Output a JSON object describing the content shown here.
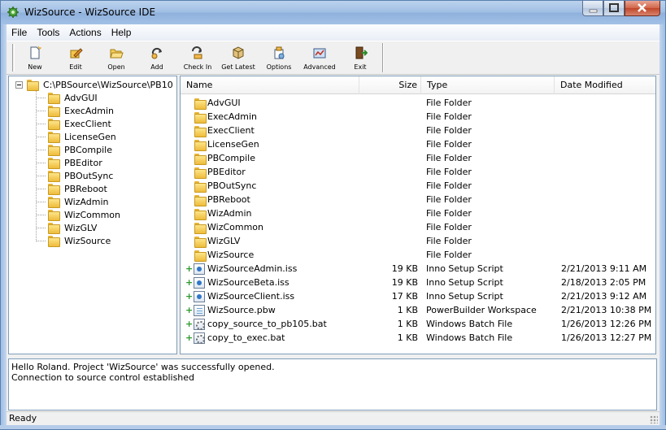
{
  "window": {
    "title": "WizSource - WizSource IDE"
  },
  "menu": [
    "File",
    "Tools",
    "Actions",
    "Help"
  ],
  "toolbar": [
    {
      "label": "New",
      "icon": "new-document-icon"
    },
    {
      "label": "Edit",
      "icon": "edit-pencil-icon"
    },
    {
      "label": "Open",
      "icon": "open-folder-icon"
    },
    {
      "label": "Add",
      "icon": "add-arrow-icon"
    },
    {
      "label": "Check In",
      "icon": "check-in-icon"
    },
    {
      "label": "Get Latest",
      "icon": "get-latest-icon"
    },
    {
      "label": "Options",
      "icon": "options-icon"
    },
    {
      "label": "Advanced",
      "icon": "advanced-icon"
    },
    {
      "label": "Exit",
      "icon": "exit-door-icon"
    }
  ],
  "tree": {
    "root": "C:\\PBSource\\WizSource\\PB10",
    "children": [
      "AdvGUI",
      "ExecAdmin",
      "ExecClient",
      "LicenseGen",
      "PBCompile",
      "PBEditor",
      "PBOutSync",
      "PBReboot",
      "WizAdmin",
      "WizCommon",
      "WizGLV",
      "WizSource"
    ]
  },
  "list": {
    "columns": [
      "Name",
      "Size",
      "Type",
      "Date Modified"
    ],
    "rows": [
      {
        "name": "AdvGUI",
        "size": "",
        "type": "File Folder",
        "date": "",
        "icon": "folder-icon",
        "added": false
      },
      {
        "name": "ExecAdmin",
        "size": "",
        "type": "File Folder",
        "date": "",
        "icon": "folder-icon",
        "added": false
      },
      {
        "name": "ExecClient",
        "size": "",
        "type": "File Folder",
        "date": "",
        "icon": "folder-icon",
        "added": false
      },
      {
        "name": "LicenseGen",
        "size": "",
        "type": "File Folder",
        "date": "",
        "icon": "folder-icon",
        "added": false
      },
      {
        "name": "PBCompile",
        "size": "",
        "type": "File Folder",
        "date": "",
        "icon": "folder-icon",
        "added": false
      },
      {
        "name": "PBEditor",
        "size": "",
        "type": "File Folder",
        "date": "",
        "icon": "folder-icon",
        "added": false
      },
      {
        "name": "PBOutSync",
        "size": "",
        "type": "File Folder",
        "date": "",
        "icon": "folder-icon",
        "added": false
      },
      {
        "name": "PBReboot",
        "size": "",
        "type": "File Folder",
        "date": "",
        "icon": "folder-icon",
        "added": false
      },
      {
        "name": "WizAdmin",
        "size": "",
        "type": "File Folder",
        "date": "",
        "icon": "folder-icon",
        "added": false
      },
      {
        "name": "WizCommon",
        "size": "",
        "type": "File Folder",
        "date": "",
        "icon": "folder-icon",
        "added": false
      },
      {
        "name": "WizGLV",
        "size": "",
        "type": "File Folder",
        "date": "",
        "icon": "folder-icon",
        "added": false
      },
      {
        "name": "WizSource",
        "size": "",
        "type": "File Folder",
        "date": "",
        "icon": "folder-icon",
        "added": false
      },
      {
        "name": "WizSourceAdmin.iss",
        "size": "19 KB",
        "type": "Inno Setup Script",
        "date": "2/21/2013 9:11 AM",
        "icon": "inno-script-icon",
        "added": true
      },
      {
        "name": "WizSourceBeta.iss",
        "size": "19 KB",
        "type": "Inno Setup Script",
        "date": "2/18/2013 2:05 PM",
        "icon": "inno-script-icon",
        "added": true
      },
      {
        "name": "WizSourceClient.iss",
        "size": "17 KB",
        "type": "Inno Setup Script",
        "date": "2/21/2013 9:12 AM",
        "icon": "inno-script-icon",
        "added": true
      },
      {
        "name": "WizSource.pbw",
        "size": "1 KB",
        "type": "PowerBuilder Workspace",
        "date": "2/21/2013 10:38 PM",
        "icon": "workspace-file-icon",
        "added": true
      },
      {
        "name": "copy_source_to_pb105.bat",
        "size": "1 KB",
        "type": "Windows Batch File",
        "date": "1/26/2013 12:26 PM",
        "icon": "batch-file-icon",
        "added": true
      },
      {
        "name": "copy_to_exec.bat",
        "size": "1 KB",
        "type": "Windows Batch File",
        "date": "1/26/2013 12:27 PM",
        "icon": "batch-file-icon",
        "added": true
      }
    ]
  },
  "log": [
    "Hello Roland. Project 'WizSource' was successfully opened.",
    "Connection to source control established"
  ],
  "status": "Ready"
}
